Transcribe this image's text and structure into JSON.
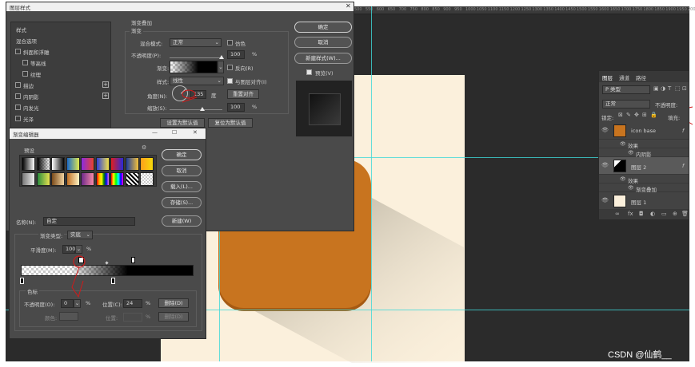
{
  "ruler": {
    "labels": [
      "500",
      "550",
      "600",
      "650",
      "700",
      "750",
      "800",
      "850",
      "900",
      "950",
      "1000",
      "1050",
      "1100",
      "1150",
      "1200",
      "1250",
      "1300",
      "1350",
      "1400",
      "1450",
      "1500",
      "1550",
      "1600",
      "1650",
      "1700",
      "1750",
      "1800",
      "1850",
      "1900",
      "1950",
      "2000"
    ]
  },
  "layer_style": {
    "title": "图层样式",
    "styles_header": "样式",
    "blend_options": "混合选项",
    "items": [
      {
        "label": "斜面和浮雕",
        "checked": false,
        "plus": false
      },
      {
        "label": "等高线",
        "checked": false,
        "plus": false
      },
      {
        "label": "纹理",
        "checked": false,
        "plus": false
      },
      {
        "label": "描边",
        "checked": false,
        "plus": true
      },
      {
        "label": "内阴影",
        "checked": false,
        "plus": true
      },
      {
        "label": "内发光",
        "checked": false,
        "plus": false
      },
      {
        "label": "光泽",
        "checked": false,
        "plus": false
      }
    ],
    "section_title": "渐变叠加",
    "section_sub": "渐变",
    "blend_mode_label": "混合模式:",
    "blend_mode_value": "正常",
    "dither_label": "仿色",
    "opacity_label": "不透明度(P):",
    "opacity_value": "100",
    "percent": "%",
    "gradient_label": "渐变:",
    "reverse_label": "反向(R)",
    "style_label": "样式:",
    "style_value": "线性",
    "align_label": "与图层对齐(I)",
    "angle_label": "角度(N):",
    "angle_value": "135",
    "degree": "度",
    "reset_align_button": "重置对齐",
    "scale_label": "缩放(S):",
    "scale_value": "100",
    "set_default_button": "设置为默认值",
    "reset_default_button": "复位为默认值",
    "ok_button": "确定",
    "cancel_button": "取消",
    "new_style_button": "新建样式(W)...",
    "preview_label": "预览(V)"
  },
  "gradient_editor": {
    "title": "渐变编辑器",
    "presets_label": "预设",
    "ok_button": "确定",
    "cancel_button": "取消",
    "load_button": "载入(L)...",
    "save_button": "存储(S)...",
    "name_label": "名称(N):",
    "name_value": "自定",
    "new_button": "新建(W)",
    "type_label": "渐变类型:",
    "type_value": "实底",
    "smoothness_label": "平滑度(M):",
    "smoothness_value": "100",
    "percent": "%",
    "stops_title": "色标",
    "opacity_label": "不透明度(O):",
    "opacity_value": "0",
    "location_label": "位置(C):",
    "location_value": "24",
    "delete_button": "删除(D)",
    "color_label": "颜色:",
    "color_location_label": "位置:",
    "color_delete_button": "删除(D)",
    "window_controls": [
      "—",
      "☐",
      "✕"
    ]
  },
  "layers_panel": {
    "tabs": [
      "图层",
      "通道",
      "路径"
    ],
    "search_placeholder": "P 类型",
    "blend_mode": "正常",
    "opacity_label": "不透明度:",
    "lock_label": "锁定:",
    "fill_label": "填充:",
    "layers": [
      {
        "name": "icon base",
        "type": "group-color"
      },
      {
        "name": "效果",
        "type": "effects"
      },
      {
        "name": "内阴影",
        "type": "effect-item"
      },
      {
        "name": "图层 2",
        "type": "selected"
      },
      {
        "name": "效果",
        "type": "effects"
      },
      {
        "name": "渐变叠加",
        "type": "effect-item"
      },
      {
        "name": "图层 1",
        "type": "plain"
      }
    ],
    "fx_label": "fx"
  },
  "watermark": "CSDN @仙鹤__",
  "colors": {
    "accent_orange": "#c8741f",
    "canvas_cream": "#fbf0dc",
    "guide_cyan": "#3fd8d8",
    "annotation_red": "#d11a1a"
  }
}
